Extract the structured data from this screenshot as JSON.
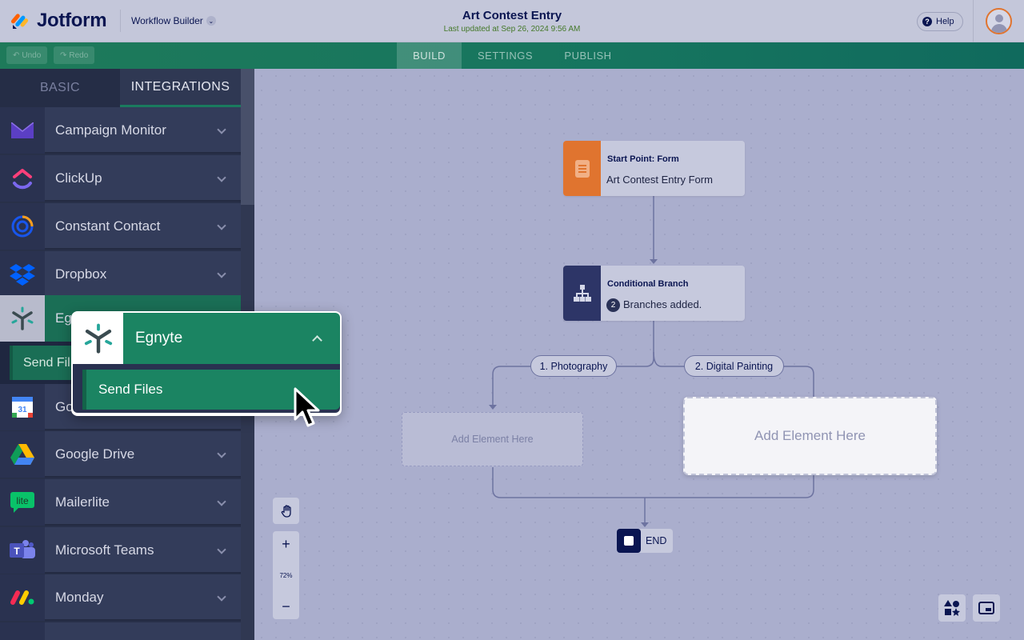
{
  "header": {
    "brand": "Jotform",
    "app_switcher": "Workflow Builder",
    "title": "Art Contest Entry",
    "subtitle": "Last updated at Sep 26, 2024 9:56 AM",
    "help_label": "Help"
  },
  "toolbar": {
    "undo_label": "Undo",
    "redo_label": "Redo",
    "tabs": [
      "BUILD",
      "SETTINGS",
      "PUBLISH"
    ],
    "active_tab": "BUILD"
  },
  "sidebar": {
    "tabs": [
      "BASIC",
      "INTEGRATIONS"
    ],
    "active_tab": "INTEGRATIONS",
    "items": [
      {
        "label": "Campaign Monitor",
        "icon": "campaign-monitor-icon"
      },
      {
        "label": "ClickUp",
        "icon": "clickup-icon"
      },
      {
        "label": "Constant Contact",
        "icon": "constant-contact-icon"
      },
      {
        "label": "Dropbox",
        "icon": "dropbox-icon"
      },
      {
        "label": "Eg",
        "icon": "egnyte-icon"
      },
      {
        "label": "Go",
        "icon": "google-calendar-icon"
      },
      {
        "label": "Google Drive",
        "icon": "google-drive-icon"
      },
      {
        "label": "Mailerlite",
        "icon": "mailerlite-icon"
      },
      {
        "label": "Microsoft Teams",
        "icon": "microsoft-teams-icon"
      },
      {
        "label": "Monday",
        "icon": "monday-icon"
      }
    ],
    "egnyte_sub_label": "Send Fil"
  },
  "flow": {
    "start": {
      "title": "Start Point: Form",
      "subtitle": "Art Contest Entry Form"
    },
    "branch": {
      "title": "Conditional Branch",
      "count": "2",
      "subtitle": "Branches added."
    },
    "branches": [
      "1. Photography",
      "2. Digital Painting"
    ],
    "placeholder_small": "Add Element Here",
    "placeholder_large": "Add Element Here",
    "end_label": "END"
  },
  "zoom": {
    "level": "72%",
    "plus": "+",
    "minus": "−"
  },
  "popup": {
    "title": "Egnyte",
    "action": "Send Files"
  },
  "colors": {
    "accent_green": "#1b8462",
    "navy": "#0a1551",
    "form_orange": "#e0742f"
  }
}
